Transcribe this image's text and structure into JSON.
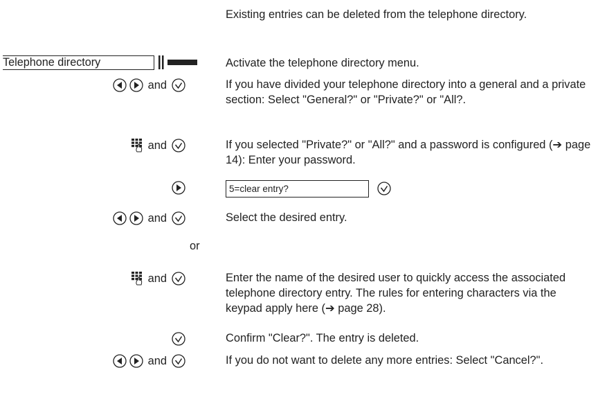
{
  "paragraphs": {
    "intro": "Existing entries can be deleted from the telephone directory.",
    "activate": "Activate the telephone directory menu.",
    "divided": "If you have divided your telephone directory into a general and a private section: Select \"General?\" or \"Private?\" or \"All?.",
    "password": "If you selected \"Private?\" or \"All?\" and a password is configured (➔ page 14): Enter your password.",
    "select_entry": "Select the desired entry.",
    "enter_name": "Enter the name of the desired user to quickly access the associated telephone directory entry. The rules for entering characters via the keypad apply here (➔ page 28).",
    "confirm": "Confirm \"Clear?\". The entry is deleted.",
    "cancel": "If you do not want to delete any more entries: Select \"Cancel?\"."
  },
  "labels": {
    "menu_name": "Telephone directory",
    "display_text": "5=clear entry?",
    "and_word": "and",
    "or_word": "or"
  },
  "icons": {
    "left": "left-arrow-button-icon",
    "right": "right-arrow-button-icon",
    "ok": "ok-check-button-icon",
    "keypad": "keypad-icon",
    "bars": "menu-bars-icon"
  }
}
